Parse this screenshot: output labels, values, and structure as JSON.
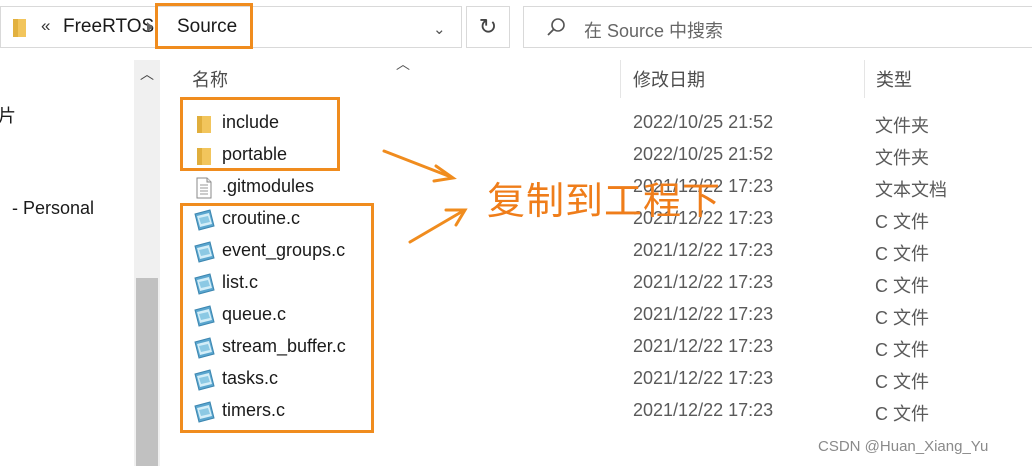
{
  "address_bar": {
    "overflow_chevron": "«",
    "crumbs": [
      "FreeRTOS",
      "Source"
    ],
    "dropdown_glyph": "⌄",
    "refresh_glyph": "↻"
  },
  "search": {
    "placeholder": "在 Source 中搜索"
  },
  "nav_pane": {
    "items": [
      "片",
      "- Personal"
    ]
  },
  "columns": {
    "name": "名称",
    "date": "修改日期",
    "type": "类型"
  },
  "files": [
    {
      "name": "include",
      "date": "2022/10/25 21:52",
      "type": "文件夹",
      "icon": "folder-icon"
    },
    {
      "name": "portable",
      "date": "2022/10/25 21:52",
      "type": "文件夹",
      "icon": "folder-icon"
    },
    {
      "name": ".gitmodules",
      "date": "2021/12/22 17:23",
      "type": "文本文档",
      "icon": "text-file-icon"
    },
    {
      "name": "croutine.c",
      "date": "2021/12/22 17:23",
      "type": "C 文件",
      "icon": "c-file-icon"
    },
    {
      "name": "event_groups.c",
      "date": "2021/12/22 17:23",
      "type": "C 文件",
      "icon": "c-file-icon"
    },
    {
      "name": "list.c",
      "date": "2021/12/22 17:23",
      "type": "C 文件",
      "icon": "c-file-icon"
    },
    {
      "name": "queue.c",
      "date": "2021/12/22 17:23",
      "type": "C 文件",
      "icon": "c-file-icon"
    },
    {
      "name": "stream_buffer.c",
      "date": "2021/12/22 17:23",
      "type": "C 文件",
      "icon": "c-file-icon"
    },
    {
      "name": "tasks.c",
      "date": "2021/12/22 17:23",
      "type": "C 文件",
      "icon": "c-file-icon"
    },
    {
      "name": "timers.c",
      "date": "2021/12/22 17:23",
      "type": "C 文件",
      "icon": "c-file-icon"
    }
  ],
  "annotation": {
    "text": "复制到工程下",
    "color": "#ef7d1a"
  },
  "watermark": "CSDN @Huan_Xiang_Yu",
  "colors": {
    "highlight": "#f08c1e",
    "folder": "#f2c55c",
    "c_file": "#5aa6cf"
  }
}
